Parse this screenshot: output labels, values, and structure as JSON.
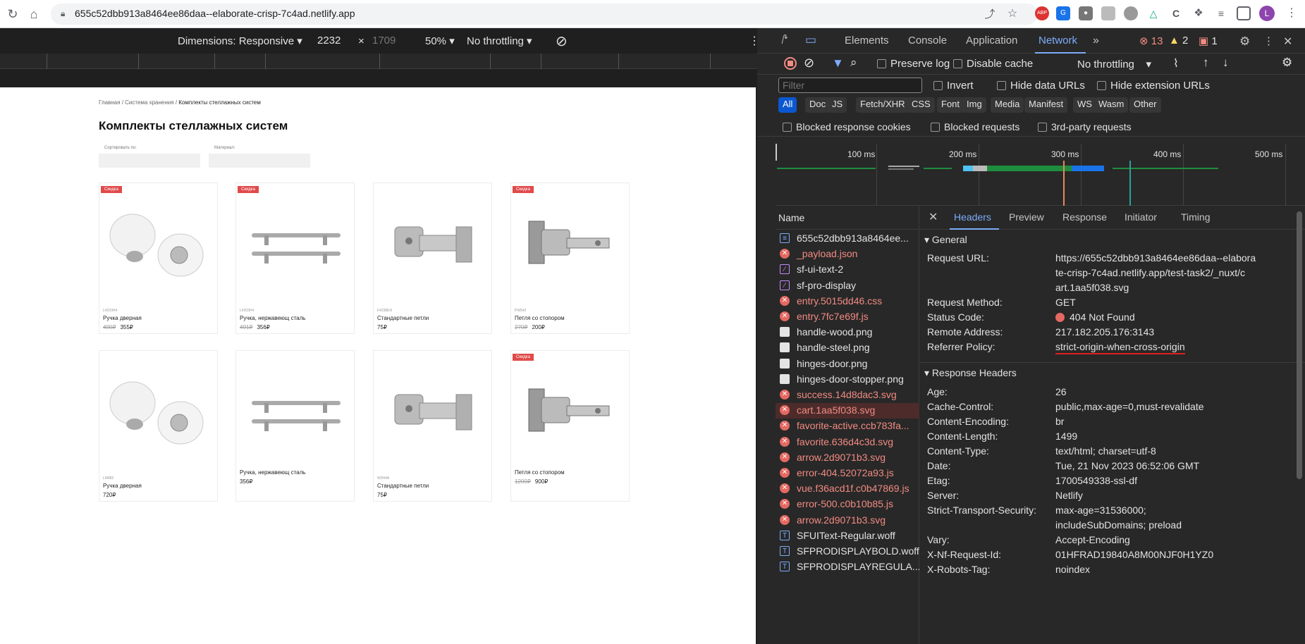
{
  "browser": {
    "url": "655c52dbb913a8464ee86daa--elaborate-crisp-7c4ad.netlify.app",
    "profile_initial": "L",
    "abp_label": "ABP"
  },
  "device_toolbar": {
    "dimensions_label": "Dimensions: Responsive",
    "width": "2232",
    "times": "×",
    "height": "1709",
    "zoom": "50%",
    "throttling": "No throttling"
  },
  "page": {
    "breadcrumb": [
      "Главная",
      "/",
      "Система хранения",
      "/",
      "Комплекты стеллажных систем"
    ],
    "title": "Комплекты стеллажных систем",
    "filter_sort_label": "Сортировать по:",
    "filter_material_label": "Материал:",
    "products": [
      {
        "badge": "Скидка",
        "sku": "L4203H4",
        "name": "Ручка дверная",
        "old_price": "400₽",
        "price": "355₽",
        "img": "knob"
      },
      {
        "badge": "Скидка",
        "sku": "L4203H4",
        "name": "Ручка, нержавеющ сталь",
        "old_price": "401₽",
        "price": "356₽",
        "img": "bar"
      },
      {
        "badge": "",
        "sku": "F4238EN",
        "name": "Стандартные петли",
        "old_price": "",
        "price": "75₽",
        "img": "hinge"
      },
      {
        "badge": "Скидка",
        "sku": "PW542",
        "name": "Петля со стопором",
        "old_price": "270₽",
        "price": "200₽",
        "img": "stopper"
      },
      {
        "badge": "",
        "sku": "LM882",
        "name": "Ручка дверная",
        "old_price": "",
        "price": "720₽",
        "img": "knob"
      },
      {
        "badge": "",
        "sku": "",
        "name": "Ручка, нержавеющ сталь",
        "old_price": "",
        "price": "356₽",
        "img": "bar"
      },
      {
        "badge": "",
        "sku": "W0H4A",
        "name": "Стандартные петли",
        "old_price": "",
        "price": "75₽",
        "img": "hinge"
      },
      {
        "badge": "Скидка",
        "sku": "",
        "name": "Петля со стопором",
        "old_price": "1200₽",
        "price": "900₽",
        "img": "stopper"
      }
    ]
  },
  "devtools": {
    "tabs": [
      "Elements",
      "Console",
      "Application",
      "Network"
    ],
    "active_tab": "Network",
    "errors": "13",
    "warnings": "2",
    "issues": "1",
    "preserve_log": "Preserve log",
    "disable_cache": "Disable cache",
    "throttling": "No throttling",
    "filter_placeholder": "Filter",
    "invert": "Invert",
    "hide_data_urls": "Hide data URLs",
    "hide_extension_urls": "Hide extension URLs",
    "types": [
      "All",
      "Doc",
      "JS",
      "Fetch/XHR",
      "CSS",
      "Font",
      "Img",
      "Media",
      "Manifest",
      "WS",
      "Wasm",
      "Other"
    ],
    "blocked_cookies": "Blocked response cookies",
    "blocked_requests": "Blocked requests",
    "third_party": "3rd-party requests",
    "timeline_ticks": [
      "100 ms",
      "200 ms",
      "300 ms",
      "400 ms",
      "500 ms"
    ],
    "name_header": "Name",
    "requests": [
      {
        "name": "655c52dbb913a8464ee...",
        "kind": "doc",
        "error": false
      },
      {
        "name": "_payload.json",
        "kind": "err",
        "error": true
      },
      {
        "name": "sf-ui-text-2",
        "kind": "font",
        "error": false
      },
      {
        "name": "sf-pro-display",
        "kind": "font",
        "error": false
      },
      {
        "name": "entry.5015dd46.css",
        "kind": "err",
        "error": true
      },
      {
        "name": "entry.7fc7e69f.js",
        "kind": "err",
        "error": true
      },
      {
        "name": "handle-wood.png",
        "kind": "img",
        "error": false
      },
      {
        "name": "handle-steel.png",
        "kind": "img",
        "error": false
      },
      {
        "name": "hinges-door.png",
        "kind": "img",
        "error": false
      },
      {
        "name": "hinges-door-stopper.png",
        "kind": "img",
        "error": false
      },
      {
        "name": "success.14d8dac3.svg",
        "kind": "err",
        "error": true
      },
      {
        "name": "cart.1aa5f038.svg",
        "kind": "err",
        "error": true
      },
      {
        "name": "favorite-active.ccb783fa...",
        "kind": "err",
        "error": true
      },
      {
        "name": "favorite.636d4c3d.svg",
        "kind": "err",
        "error": true
      },
      {
        "name": "arrow.2d9071b3.svg",
        "kind": "err",
        "error": true
      },
      {
        "name": "error-404.52072a93.js",
        "kind": "err",
        "error": true
      },
      {
        "name": "vue.f36acd1f.c0b47869.js",
        "kind": "err",
        "error": true
      },
      {
        "name": "error-500.c0b10b85.js",
        "kind": "err",
        "error": true
      },
      {
        "name": "arrow.2d9071b3.svg",
        "kind": "err",
        "error": true
      },
      {
        "name": "SFUIText-Regular.woff",
        "kind": "woff",
        "error": false
      },
      {
        "name": "SFPRODISPLAYBOLD.woff",
        "kind": "woff",
        "error": false
      },
      {
        "name": "SFPRODISPLAYREGULA...",
        "kind": "woff",
        "error": false
      }
    ],
    "selected_request_index": 11,
    "header_tabs": [
      "Headers",
      "Preview",
      "Response",
      "Initiator",
      "Timing"
    ],
    "active_header_tab": "Headers",
    "general_title": "General",
    "general": [
      {
        "k": "Request URL:",
        "v": [
          "https://655c52dbb913a8464ee86daa--elabora",
          "te-crisp-7c4ad.netlify.app/test-task2/_nuxt/c",
          "art.1aa5f038.svg"
        ]
      },
      {
        "k": "Request Method:",
        "v": [
          "GET"
        ]
      },
      {
        "k": "Status Code:",
        "v": [
          "404 Not Found"
        ]
      },
      {
        "k": "Remote Address:",
        "v": [
          "217.182.205.176:3143"
        ]
      },
      {
        "k": "Referrer Policy:",
        "v": [
          "strict-origin-when-cross-origin"
        ]
      }
    ],
    "response_title": "Response Headers",
    "response": [
      {
        "k": "Age:",
        "v": [
          "26"
        ]
      },
      {
        "k": "Cache-Control:",
        "v": [
          "public,max-age=0,must-revalidate"
        ]
      },
      {
        "k": "Content-Encoding:",
        "v": [
          "br"
        ]
      },
      {
        "k": "Content-Length:",
        "v": [
          "1499"
        ]
      },
      {
        "k": "Content-Type:",
        "v": [
          "text/html; charset=utf-8"
        ]
      },
      {
        "k": "Date:",
        "v": [
          "Tue, 21 Nov 2023 06:52:06 GMT"
        ]
      },
      {
        "k": "Etag:",
        "v": [
          "1700549338-ssl-df"
        ]
      },
      {
        "k": "Server:",
        "v": [
          "Netlify"
        ]
      },
      {
        "k": "Strict-Transport-Security:",
        "v": [
          "max-age=31536000;",
          "includeSubDomains; preload"
        ]
      },
      {
        "k": "Vary:",
        "v": [
          "Accept-Encoding"
        ]
      },
      {
        "k": "X-Nf-Request-Id:",
        "v": [
          "01HFRAD19840A8M00NJF0H1YZ0"
        ]
      },
      {
        "k": "X-Robots-Tag:",
        "v": [
          "noindex"
        ]
      }
    ],
    "colors": {
      "accent": "#7cacf8",
      "error": "#f28b82",
      "status_red": "#e46962",
      "underline": "#e02020"
    }
  }
}
